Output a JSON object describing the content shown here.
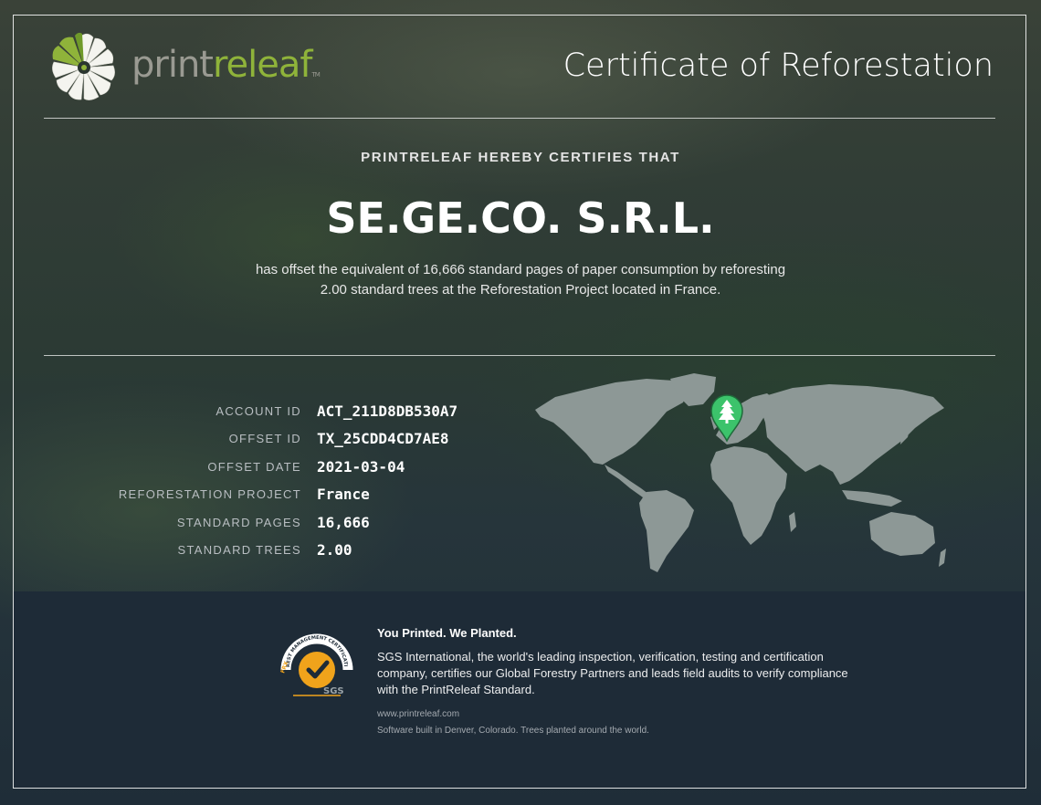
{
  "brand": {
    "name_part1": "print",
    "name_part2": "releaf",
    "trademark": "TM",
    "grey": "#9a9a92",
    "green": "#8fb33a"
  },
  "header": {
    "certificate_title": "Certificate of Reforestation"
  },
  "certification": {
    "intro": "PRINTRELEAF HEREBY CERTIFIES THAT",
    "company": "SE.GE.CO. S.R.L.",
    "statement": "has offset the equivalent of 16,666 standard pages of paper consumption by reforesting 2.00 standard trees at the Reforestation Project located in France."
  },
  "details": [
    {
      "label": "ACCOUNT ID",
      "value": "ACT_211D8DB530A7"
    },
    {
      "label": "OFFSET ID",
      "value": "TX_25CDD4CD7AE8"
    },
    {
      "label": "OFFSET DATE",
      "value": "2021-03-04"
    },
    {
      "label": "REFORESTATION PROJECT",
      "value": "France"
    },
    {
      "label": "STANDARD PAGES",
      "value": "16,666"
    },
    {
      "label": "STANDARD TREES",
      "value": "2.00"
    }
  ],
  "map": {
    "icon": "tree-location-pin-icon",
    "pin_color": "#3cc36b",
    "land_color": "#8d9896"
  },
  "seal": {
    "icon": "sgs-certification-seal-icon",
    "ring_text": "FOREST MANAGEMENT CERTIFICATION",
    "side_text": "FRX",
    "mark_text": "SGS",
    "accent": "#f0a31b"
  },
  "footer": {
    "heading": "You Printed. We Planted.",
    "body": "SGS International, the world's leading inspection, verification, testing and certification company, certifies our Global Forestry Partners and leads field audits to verify compliance with the PrintReleaf Standard.",
    "url": "www.printreleaf.com",
    "tagline": "Software built in Denver, Colorado. Trees planted around the world."
  }
}
